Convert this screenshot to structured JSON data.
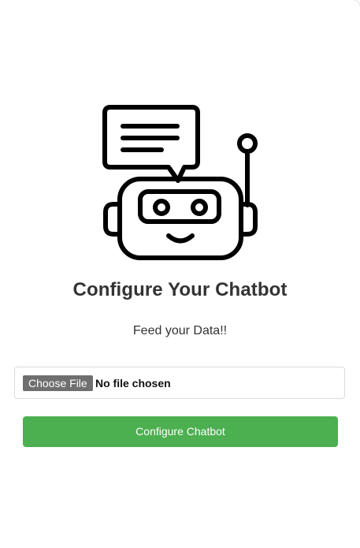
{
  "colors": {
    "accent": "#4caf50",
    "text": "#333333",
    "file_button": "#6f6f6f",
    "border": "#dcdcdc"
  },
  "illustration": {
    "icon": "robot-chatbot-icon"
  },
  "header": {
    "title": "Configure Your Chatbot",
    "subtitle": "Feed your Data!!"
  },
  "file_input": {
    "button_label": "Choose File",
    "status": "No file chosen"
  },
  "actions": {
    "configure_label": "Configure Chatbot"
  }
}
